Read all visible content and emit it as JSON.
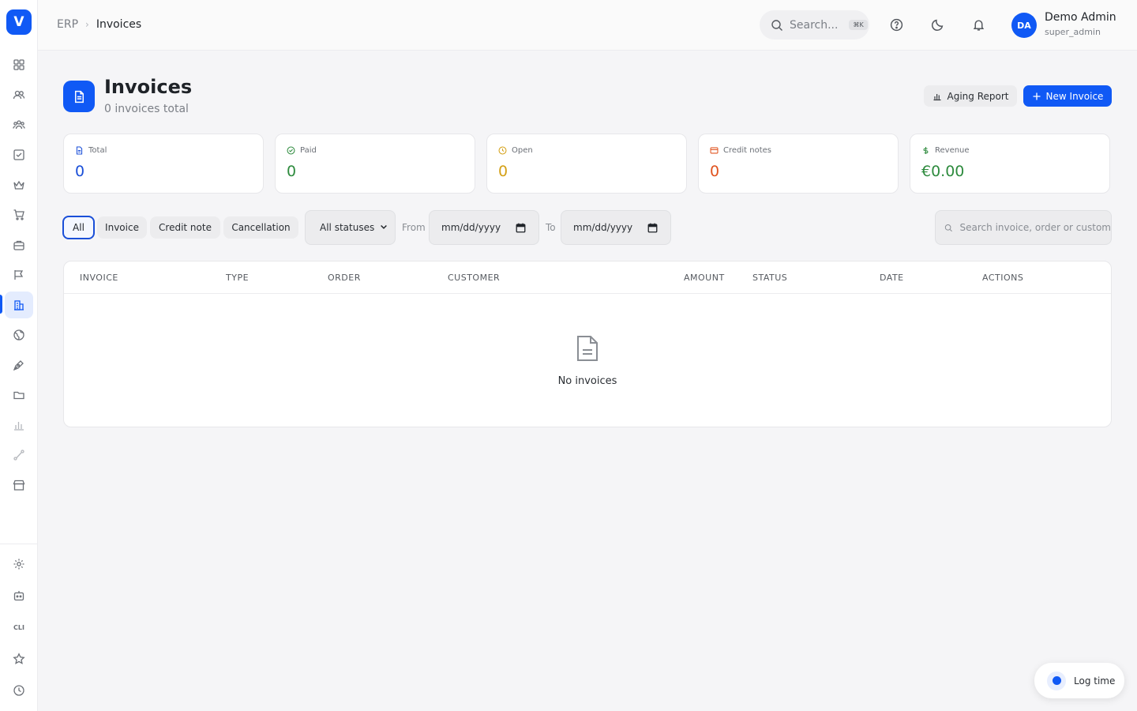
{
  "app": {
    "logo_letter": "V",
    "accent": "#1059f5"
  },
  "sidebar": {
    "items": [
      {
        "name": "dashboard-grid-icon"
      },
      {
        "name": "contacts-icon"
      },
      {
        "name": "team-icon"
      },
      {
        "name": "tasks-checkbox-icon"
      },
      {
        "name": "crown-icon"
      },
      {
        "name": "cart-icon"
      },
      {
        "name": "briefcase-icon"
      },
      {
        "name": "campaign-flag-icon"
      },
      {
        "name": "erp-building-icon",
        "active": true
      },
      {
        "name": "globe-icon"
      },
      {
        "name": "pen-nib-icon"
      },
      {
        "name": "folder-icon"
      },
      {
        "name": "analytics-bars-icon"
      },
      {
        "name": "workflow-route-icon"
      },
      {
        "name": "store-icon"
      }
    ],
    "bottom": [
      {
        "name": "settings-gear-icon"
      },
      {
        "name": "bot-icon"
      },
      {
        "name": "cli-label",
        "label": "CLI"
      },
      {
        "name": "star-icon"
      },
      {
        "name": "clock-icon"
      }
    ]
  },
  "topbar": {
    "breadcrumb": {
      "root": "ERP",
      "current": "Invoices"
    },
    "search": {
      "placeholder": "Search...",
      "shortcut": "⌘K"
    },
    "user": {
      "initials": "DA",
      "name": "Demo Admin",
      "role": "super_admin"
    }
  },
  "header": {
    "title": "Invoices",
    "subtitle": "0 invoices total",
    "aging_report_label": "Aging Report",
    "new_invoice_label": "New Invoice"
  },
  "stats": [
    {
      "label": "Total",
      "value": "0",
      "color": "#1a4fd8",
      "icon": "document-icon"
    },
    {
      "label": "Paid",
      "value": "0",
      "color": "#2e8b3e",
      "icon": "check-circle-icon"
    },
    {
      "label": "Open",
      "value": "0",
      "color": "#d4a017",
      "icon": "clock-icon"
    },
    {
      "label": "Credit notes",
      "value": "0",
      "color": "#e0531f",
      "icon": "credit-card-icon"
    },
    {
      "label": "Revenue",
      "value": "€0.00",
      "color": "#2e8b3e",
      "icon": "dollar-icon"
    }
  ],
  "filters": {
    "type_tabs": [
      "All",
      "Invoice",
      "Credit note",
      "Cancellation"
    ],
    "active_tab": "All",
    "status_select": "All statuses",
    "from_label": "From",
    "to_label": "To",
    "date_placeholder": "mm/dd/yyyy",
    "search_placeholder": "Search invoice, order or custom"
  },
  "table": {
    "columns": [
      "INVOICE",
      "TYPE",
      "ORDER",
      "CUSTOMER",
      "AMOUNT",
      "STATUS",
      "DATE",
      "ACTIONS"
    ],
    "rows": [],
    "empty_text": "No invoices"
  },
  "log_time": {
    "label": "Log time"
  }
}
